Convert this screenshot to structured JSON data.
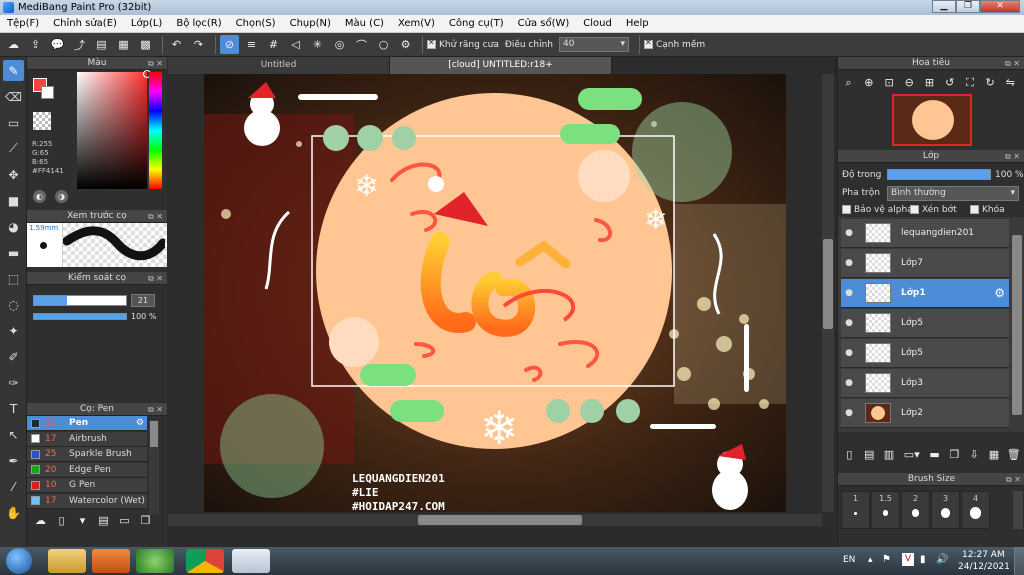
{
  "window": {
    "title": "MediBang Paint Pro (32bit)",
    "controls": [
      "▁",
      "❐",
      "✕"
    ]
  },
  "menu": [
    "Tệp(F)",
    "Chỉnh sửa(E)",
    "Lớp(L)",
    "Bộ lọc(R)",
    "Chọn(S)",
    "Chụp(N)",
    "Màu (C)",
    "Xem(V)",
    "Công cụ(T)",
    "Cửa sổ(W)",
    "Cloud",
    "Help"
  ],
  "toolbar": {
    "antialias_label": "Khử răng cưa",
    "adjust_label": "Điều chỉnh",
    "adjust_value": "40",
    "sharp_edge_label": "Cạnh mềm"
  },
  "color_panel": {
    "title": "Màu",
    "fg_color": "#FF4141",
    "r": "R:255",
    "g": "G:65",
    "b": "B:65",
    "hex": "#FF4141"
  },
  "brush_preview": {
    "title": "Xem trước cọ",
    "size": "1.59mm"
  },
  "brush_control": {
    "title": "Kiểm soát cọ",
    "size_value": "21",
    "opacity_value": "100 %",
    "size_fraction": 0.36,
    "opacity_fraction": 1.0
  },
  "brush_list": {
    "title": "Cọ: Pen",
    "items": [
      {
        "size": "21",
        "name": "Pen",
        "color": "#1c2a3a",
        "selected": true
      },
      {
        "size": "17",
        "name": "Airbrush",
        "color": "#ffffff"
      },
      {
        "size": "25",
        "name": "Sparkle Brush",
        "color": "#2a4fd6"
      },
      {
        "size": "20",
        "name": "Edge Pen",
        "color": "#1aa61a"
      },
      {
        "size": "10",
        "name": "G Pen",
        "color": "#d8201c"
      },
      {
        "size": "17",
        "name": "Watercolor (Wet)",
        "color": "#6ac3ff"
      }
    ]
  },
  "canvas_tabs": [
    "Untitled",
    "[cloud] UNTITLED:r18+"
  ],
  "artwork": {
    "watermark_lines": [
      "LEQUANGDIEN201",
      "#LIE",
      "#HOIDAP247.COM"
    ],
    "center_text": "Cố"
  },
  "navigator": {
    "title": "Hoa tiêu"
  },
  "layer_panel": {
    "title": "Lớp",
    "opacity_label": "Độ trong",
    "opacity_value": "100 %",
    "opacity_fraction": 1.0,
    "blend_label": "Pha trộn",
    "blend_value": "Bình thường",
    "protect_alpha": "Bảo vệ alpha",
    "clipping": "Xén bớt",
    "lock": "Khóa",
    "layers": [
      {
        "name": "lequangdien201",
        "selected": false
      },
      {
        "name": "Lớp7",
        "selected": false
      },
      {
        "name": "Lớp1",
        "selected": true
      },
      {
        "name": "Lớp5",
        "selected": false
      },
      {
        "name": "Lớp5",
        "selected": false
      },
      {
        "name": "Lớp3",
        "selected": false
      },
      {
        "name": "Lớp2",
        "selected": false
      }
    ]
  },
  "brush_size_panel": {
    "title": "Brush Size",
    "sizes": [
      "1",
      "1.5",
      "2",
      "3",
      "4"
    ]
  },
  "taskbar": {
    "lang": "EN",
    "time": "12:27 AM",
    "date": "24/12/2021"
  }
}
